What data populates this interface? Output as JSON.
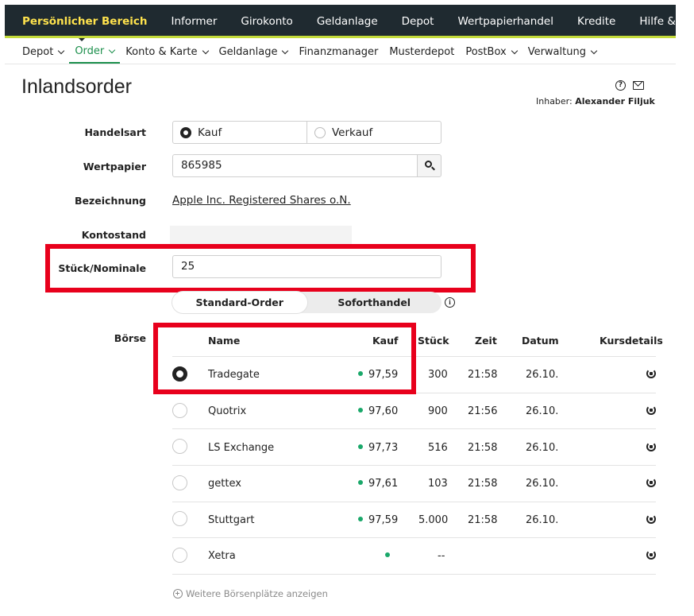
{
  "topnav": {
    "items": [
      "Persönlicher Bereich",
      "Informer",
      "Girokonto",
      "Geldanlage",
      "Depot",
      "Wertpapierhandel",
      "Kredite",
      "Hilfe & Service"
    ],
    "active_color": "#ffe34d",
    "bg_color": "#1f2a30",
    "accent_color": "#c3da3a"
  },
  "subnav": {
    "items": [
      {
        "label": "Depot",
        "has_dropdown": true
      },
      {
        "label": "Order",
        "has_dropdown": true
      },
      {
        "label": "Konto & Karte",
        "has_dropdown": true
      },
      {
        "label": "Geldanlage",
        "has_dropdown": true
      },
      {
        "label": "Finanzmanager",
        "has_dropdown": false
      },
      {
        "label": "Musterdepot",
        "has_dropdown": false
      },
      {
        "label": "PostBox",
        "has_dropdown": true
      },
      {
        "label": "Verwaltung",
        "has_dropdown": true
      }
    ],
    "active": "Order",
    "active_color": "#1c8f4c"
  },
  "page": {
    "title": "Inlandsorder",
    "owner_label": "Inhaber:",
    "owner_name": "Alexander Filjuk",
    "icons": [
      "help-icon",
      "mail-icon"
    ]
  },
  "form": {
    "handelsart_label": "Handelsart",
    "handelsart_options": [
      "Kauf",
      "Verkauf"
    ],
    "handelsart_selected": "Kauf",
    "wertpapier_label": "Wertpapier",
    "wertpapier_value": "865985",
    "bezeichnung_label": "Bezeichnung",
    "bezeichnung_value": "Apple Inc. Registered Shares o.N.",
    "kontostand_label": "Kontostand",
    "kontostand_value": "",
    "stueck_label": "Stück/Nominale",
    "stueck_value": "25",
    "ordertype_options": [
      "Standard-Order",
      "Soforthandel"
    ],
    "ordertype_selected": "Standard-Order"
  },
  "boerse": {
    "label": "Börse",
    "columns": [
      "Name",
      "Kauf",
      "Stück",
      "Zeit",
      "Datum",
      "Kursdetails"
    ],
    "rows": [
      {
        "name": "Tradegate",
        "kauf": "97,59",
        "stueck": "300",
        "zeit": "21:58",
        "datum": "26.10.",
        "selected": true
      },
      {
        "name": "Quotrix",
        "kauf": "97,60",
        "stueck": "900",
        "zeit": "21:56",
        "datum": "26.10.",
        "selected": false
      },
      {
        "name": "LS Exchange",
        "kauf": "97,73",
        "stueck": "516",
        "zeit": "21:58",
        "datum": "26.10.",
        "selected": false
      },
      {
        "name": "gettex",
        "kauf": "97,61",
        "stueck": "103",
        "zeit": "21:58",
        "datum": "26.10.",
        "selected": false
      },
      {
        "name": "Stuttgart",
        "kauf": "97,59",
        "stueck": "5.000",
        "zeit": "21:58",
        "datum": "26.10.",
        "selected": false
      },
      {
        "name": "Xetra",
        "kauf": "",
        "stueck": "--",
        "zeit": "",
        "datum": "",
        "selected": false
      }
    ],
    "status_dot_color": "#1aa86a",
    "more_label": "Weitere Börsenplätze anzeigen"
  },
  "highlight_color": "#e8001c"
}
